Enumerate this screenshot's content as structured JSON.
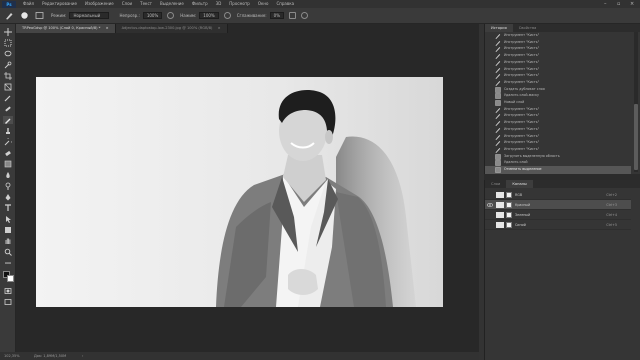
{
  "app": {
    "logo": "Ps"
  },
  "menu": [
    "Файл",
    "Редактирование",
    "Изображение",
    "Слои",
    "Текст",
    "Выделение",
    "Фильтр",
    "3D",
    "Просмотр",
    "Окно",
    "Справка"
  ],
  "options": {
    "mode_label": "Режим:",
    "mode_value": "Нормальный",
    "opacity_label": "Непрозр.:",
    "opacity_value": "100%",
    "flow_label": "Нажим:",
    "flow_value": "100%",
    "smoothing_label": "Сглаживание:",
    "smoothing_value": "0%"
  },
  "tabs": [
    {
      "label": "TRPeoGdsp @ 100% (Слой 0, Красный/8) *",
      "close": "×"
    },
    {
      "label": "Adjectus-daptostop-low-2300.jpg @ 100% (RGB/8)",
      "close": "×"
    }
  ],
  "status": {
    "zoom": "102,35%",
    "doc": "Док: 1,89М/1,50М",
    "arrow": "›"
  },
  "history": {
    "tabs": [
      "История",
      "Свойства"
    ],
    "items": [
      "Инструмент \"Кисть\"",
      "Инструмент \"Кисть\"",
      "Инструмент \"Кисть\"",
      "Инструмент \"Кисть\"",
      "Инструмент \"Кисть\"",
      "Инструмент \"Кисть\"",
      "Инструмент \"Кисть\"",
      "Инструмент \"Кисть\"",
      "Создать дубликат слоя",
      "Удалить слой-маску",
      "Новый слой",
      "Инструмент \"Кисть\"",
      "Инструмент \"Кисть\"",
      "Инструмент \"Кисть\"",
      "Инструмент \"Кисть\"",
      "Инструмент \"Кисть\"",
      "Инструмент \"Кисть\"",
      "Инструмент \"Кисть\"",
      "Загрузить выделенную область",
      "Удалить слой",
      "Отменить выделение"
    ],
    "selected_index": 20
  },
  "layers": {
    "tabs": [
      "Слои",
      "Каналы"
    ],
    "rows": [
      {
        "name": "RGB",
        "shortcut": "Ctrl+2",
        "visible": false
      },
      {
        "name": "Красный",
        "shortcut": "Ctrl+3",
        "visible": true
      },
      {
        "name": "Зеленый",
        "shortcut": "Ctrl+4",
        "visible": false
      },
      {
        "name": "Синий",
        "shortcut": "Ctrl+5",
        "visible": false
      }
    ]
  },
  "colors": {
    "accent": "#31a8ff",
    "panel": "#353535",
    "selected": "#565656"
  }
}
